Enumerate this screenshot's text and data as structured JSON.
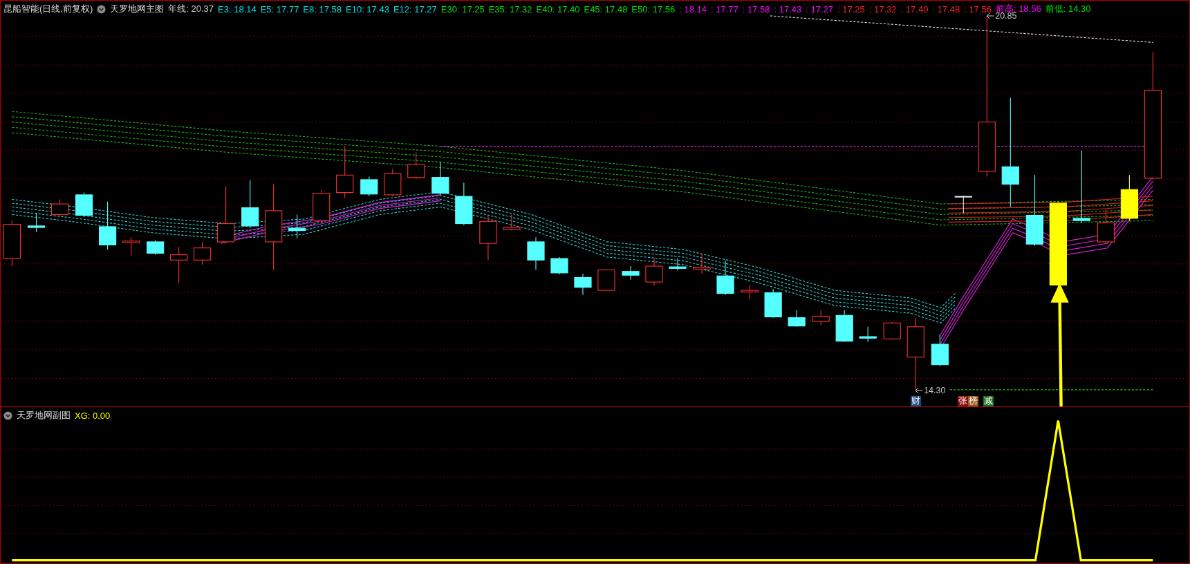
{
  "header": {
    "title": "昆船智能(日线,前复权)",
    "indicator": "天罗地网主图",
    "legend": [
      {
        "text": "年线: 20.37",
        "color": "#d0d0d0"
      },
      {
        "text": "E3: 18.14",
        "color": "#00e0e0"
      },
      {
        "text": "E5: 17.77",
        "color": "#00e0e0"
      },
      {
        "text": "E8: 17.58",
        "color": "#00e0e0"
      },
      {
        "text": "E10: 17.43",
        "color": "#00e0e0"
      },
      {
        "text": "E12: 17.27",
        "color": "#00e0e0"
      },
      {
        "text": "E30: 17.25",
        "color": "#00e000"
      },
      {
        "text": "E35: 17.32",
        "color": "#00e000"
      },
      {
        "text": "E40: 17.40",
        "color": "#00e000"
      },
      {
        "text": "E45: 17.48",
        "color": "#00e000"
      },
      {
        "text": "E50: 17.56",
        "color": "#00e000"
      },
      {
        "text": ": 18.14",
        "color": "#ff00ff"
      },
      {
        "text": ": 17.77",
        "color": "#ff00ff"
      },
      {
        "text": ": 17.58",
        "color": "#ff00ff"
      },
      {
        "text": ": 17.43",
        "color": "#ff00ff"
      },
      {
        "text": ": 17.27",
        "color": "#ff00ff"
      },
      {
        "text": ": 17.25",
        "color": "#ff2020"
      },
      {
        "text": ": 17.32",
        "color": "#ff2020"
      },
      {
        "text": ": 17.40",
        "color": "#ff2020"
      },
      {
        "text": ": 17.48",
        "color": "#ff2020"
      },
      {
        "text": ": 17.56",
        "color": "#ff2020"
      },
      {
        "text": "前高: 18.56",
        "color": "#ff00ff"
      },
      {
        "text": "前低: 14.30",
        "color": "#00e000"
      }
    ]
  },
  "price_marks": [
    {
      "kind": "high",
      "value": "20.85"
    },
    {
      "kind": "low",
      "value": "14.30"
    }
  ],
  "tags": [
    {
      "text": "财",
      "color": "#1f4a80"
    },
    {
      "text": "张",
      "color": "#900c0c"
    },
    {
      "text": "榜",
      "color": "#9a5a14"
    },
    {
      "text": "减",
      "color": "#187018"
    }
  ],
  "sub_panel": {
    "indicator": "天罗地网副图",
    "legend": [
      {
        "text": "XG: 0.00",
        "color": "#ffff00"
      }
    ]
  }
}
